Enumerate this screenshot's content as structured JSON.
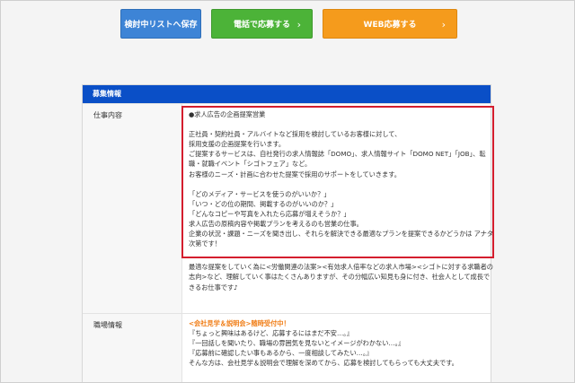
{
  "buttons": {
    "save_label": "検討中リストへ保存",
    "phone_label": "電話で応募する",
    "web_label": "WEB応募する",
    "chevron": "›"
  },
  "section": {
    "header": "募集情報"
  },
  "job_description": {
    "label": "仕事内容",
    "highlighted_lines": [
      "●求人広告の企画提案営業",
      "",
      "正社員・契約社員・アルバイトなど採用を検討しているお客様に対して、",
      "採用支援の企画提案を行います。",
      "ご提案するサービスは、自社発行の求人情報誌「DOMO」、求人情報サイト「DOMO NET」「JOB」、転",
      "職・就職イベント「シゴトフェア」など。",
      "お客様のニーズ・計画に合わせた提案で採用のサポートをしていきます。",
      "",
      "「どのメディア・サービスを使うのがいいか？」",
      "「いつ・どの位の期間、掲載するのがいいのか？」",
      "「どんなコピーや写真を入れたら応募が増えそうか？」",
      "求人広告の原稿内容や掲載プランを考えるのも営業の仕事。",
      "企業の状況・課題・ニーズを聞き出し、それらを解決できる最適なプランを提案できるかどうかは アナタ",
      "次第です！"
    ],
    "extra_lines": [
      "最適な提案をしていく為に<労働関連の法案><有効求人倍率などの求人市場><シゴトに対する求職者の",
      "志向>など、理解していく事はたくさんありますが、その分幅広い知見も身に付き、社会人として成長で",
      "きるお仕事です♪"
    ]
  },
  "workplace": {
    "label": "職場情報",
    "headline": "<会社見学＆説明会>随時受付中！",
    "lines": [
      "『ちょっと興味はあるけど、応募するにはまだ不安…。』",
      "『一回話しを聞いたり、職場の雰囲気を見ないとイメージがわかない…。』",
      "『応募前に確認したい事もあるから、一度相談してみたい…。』",
      "そんな方は、会社見学＆説明会で理解を深めてから、応募を検討してもらっても大丈夫です。"
    ]
  }
}
